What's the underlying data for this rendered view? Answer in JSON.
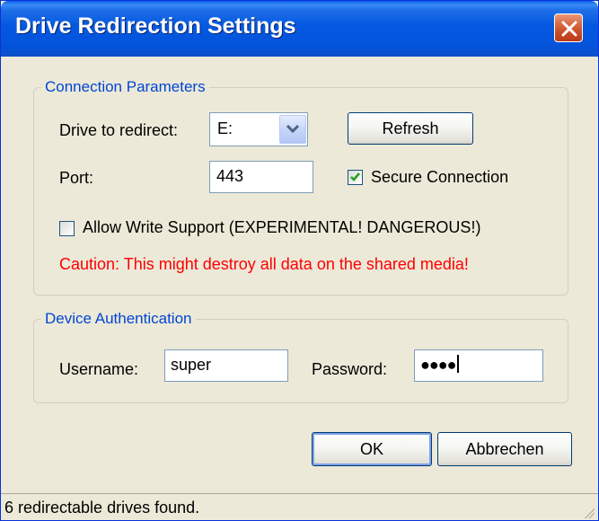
{
  "window": {
    "title": "Drive Redirection Settings",
    "title_bar_color": "#0458e0",
    "close_icon": "close-icon"
  },
  "connection": {
    "legend": "Connection Parameters",
    "drive_label": "Drive to redirect:",
    "drive_value": "E:",
    "refresh_label": "Refresh",
    "port_label": "Port:",
    "port_value": "443",
    "secure_label": "Secure Connection",
    "secure_checked": true,
    "write_label": "Allow Write Support (EXPERIMENTAL! DANGEROUS!)",
    "write_checked": false,
    "caution_text": "Caution: This might destroy all data on the shared media!",
    "caution_color": "#ff0000"
  },
  "auth": {
    "legend": "Device Authentication",
    "username_label": "Username:",
    "username_value": "super",
    "password_label": "Password:",
    "password_value": "●●●●"
  },
  "buttons": {
    "ok": "OK",
    "cancel": "Abbrechen"
  },
  "status": {
    "text": "6 redirectable drives found."
  },
  "colors": {
    "dialog_bg": "#ece9d8",
    "legend": "#0046d5",
    "checkmark": "#21a121"
  }
}
